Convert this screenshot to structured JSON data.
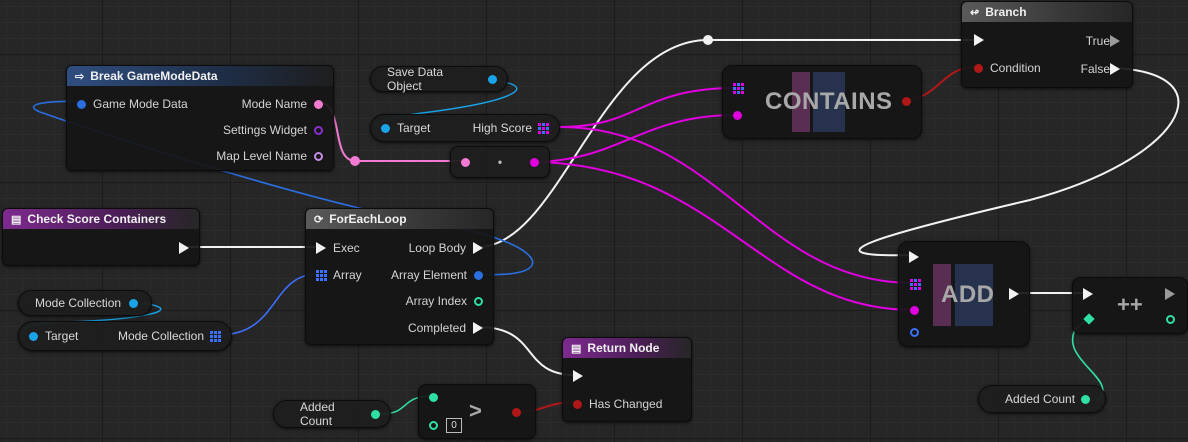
{
  "colors": {
    "exec": "#f2f2f2",
    "struct": "#2a6ee0",
    "string": "#f27ad2",
    "object": "#1aa3e8",
    "widget": "#8a2fcf",
    "name": "#c58ce6",
    "integer": "#2fdfa6",
    "bool": "#b01818",
    "array_pin": "#e000e0",
    "array_blue": "#3c70ff"
  },
  "nodes": {
    "break_gamemodedata": {
      "title": "Break GameModeData",
      "icon": "break-struct-icon",
      "pins": {
        "game_mode_data": "Game Mode Data",
        "mode_name": "Mode Name",
        "settings_widget": "Settings Widget",
        "map_level_name": "Map Level Name"
      }
    },
    "save_data_object": {
      "label": "Save Data Object"
    },
    "get_high_score": {
      "target": "Target",
      "output": "High Score"
    },
    "make_literal": {
      "label": "•"
    },
    "contains": {
      "label": "CONTAINS"
    },
    "branch": {
      "title": "Branch",
      "icon": "branch-icon",
      "pins": {
        "condition": "Condition",
        "true": "True",
        "false": "False"
      }
    },
    "check_score_containers": {
      "title": "Check Score Containers",
      "icon": "function-entry-icon"
    },
    "foreachloop": {
      "title": "ForEachLoop",
      "icon": "loop-icon",
      "pins": {
        "exec": "Exec",
        "array": "Array",
        "loop_body": "Loop Body",
        "array_element": "Array Element",
        "array_index": "Array Index",
        "completed": "Completed"
      }
    },
    "mode_collection_var": {
      "label": "Mode Collection"
    },
    "get_mode_collection": {
      "target": "Target",
      "output": "Mode Collection"
    },
    "add": {
      "label": "ADD"
    },
    "increment": {
      "label": "++"
    },
    "added_count_1": {
      "label": "Added Count"
    },
    "added_count_2": {
      "label": "Added Count"
    },
    "greater": {
      "label": ">",
      "literal": "0"
    },
    "return_node": {
      "title": "Return Node",
      "icon": "return-icon",
      "pins": {
        "has_changed": "Has Changed"
      }
    }
  }
}
